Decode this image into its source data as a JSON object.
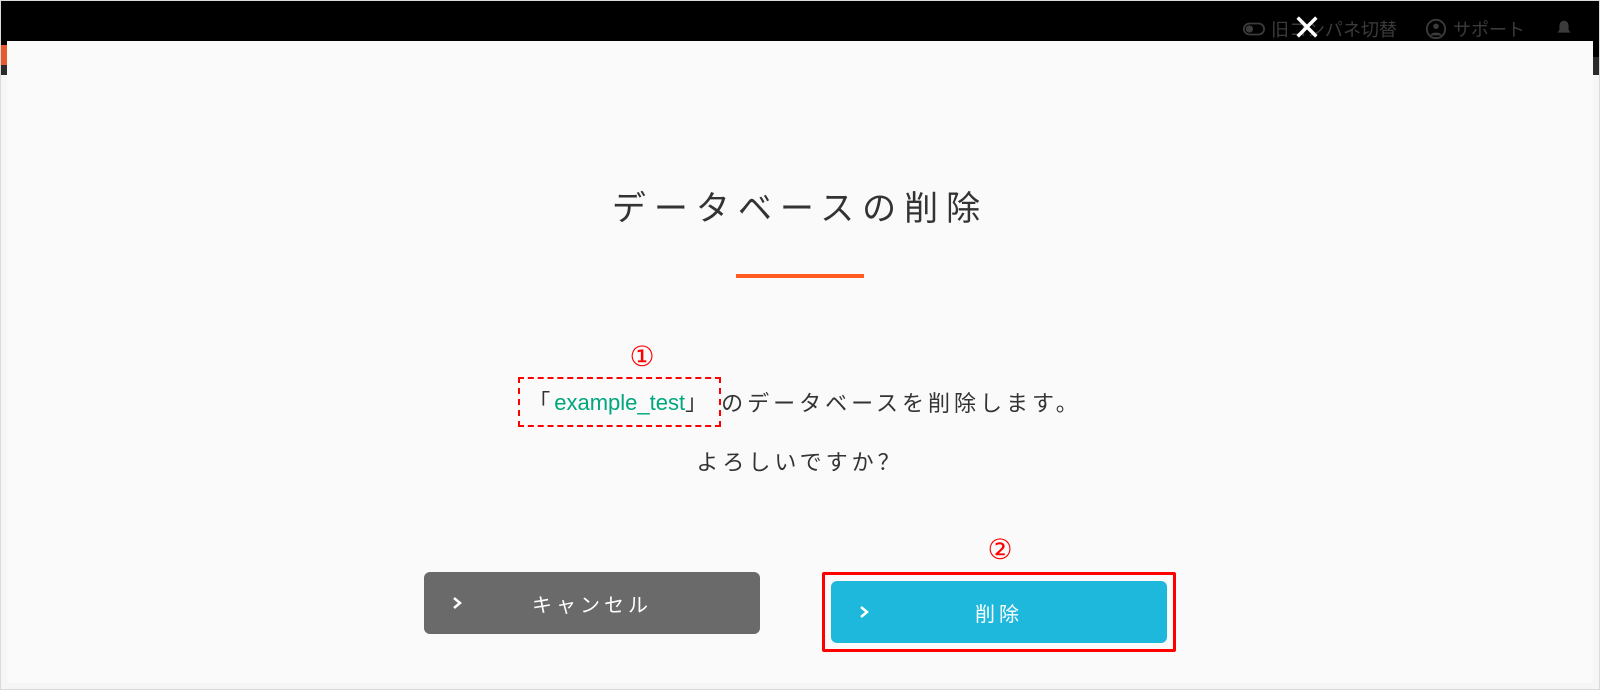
{
  "topbar": {
    "toggle_label": "旧コンパネ切替",
    "support_label": "サポート"
  },
  "modal": {
    "title": "データベースの削除",
    "bracket_open": "「",
    "database_name": "example_test",
    "bracket_close": "」",
    "confirm_suffix": "のデータベースを削除します。",
    "confirm_line2": "よろしいですか？",
    "cancel_label": "キャンセル",
    "delete_label": "削除"
  },
  "annotations": {
    "marker1": "①",
    "marker2": "②"
  },
  "colors": {
    "accent_orange": "#ff5a1f",
    "db_name_green": "#00a67e",
    "annotation_red": "#ff0000",
    "delete_button": "#1eb8dd",
    "cancel_button": "#6a6a6a"
  }
}
